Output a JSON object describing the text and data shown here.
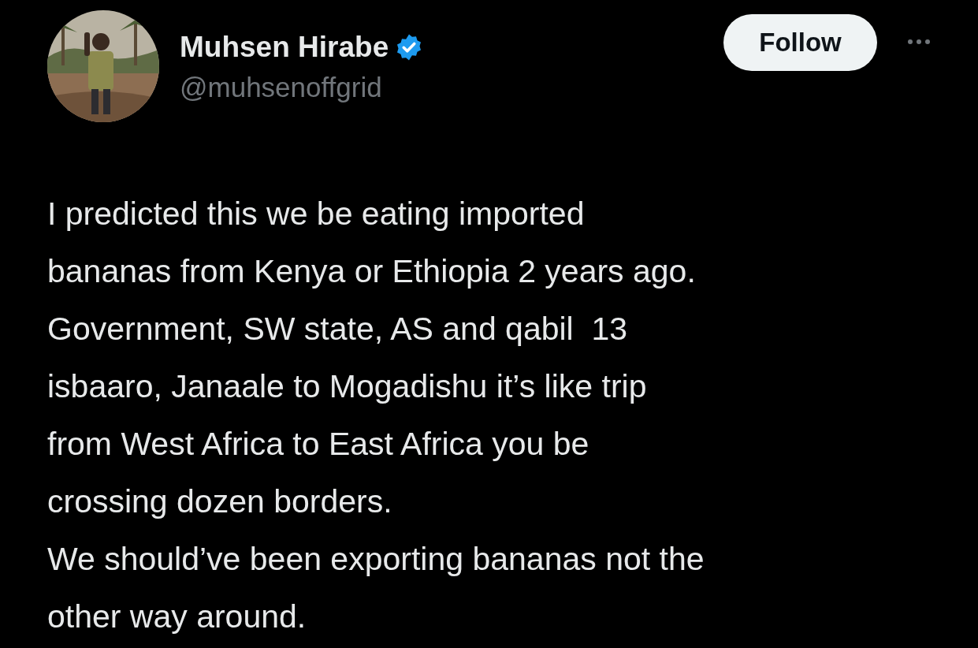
{
  "author": {
    "name": "Muhsen Hirabe",
    "verified": true,
    "handle": "@muhsenoffgrid"
  },
  "follow_button": {
    "label": "Follow"
  },
  "tweet": {
    "paragraphs": [
      "I predicted this we be eating imported\nbananas from Kenya or Ethiopia 2 years ago.\nGovernment, SW state, AS and qabil  13\nisbaaro, Janaale to Mogadishu it’s like trip\nfrom West Africa to East Africa you be\ncrossing dozen borders.",
      "We should’ve been exporting bananas not the\nother way around."
    ]
  }
}
